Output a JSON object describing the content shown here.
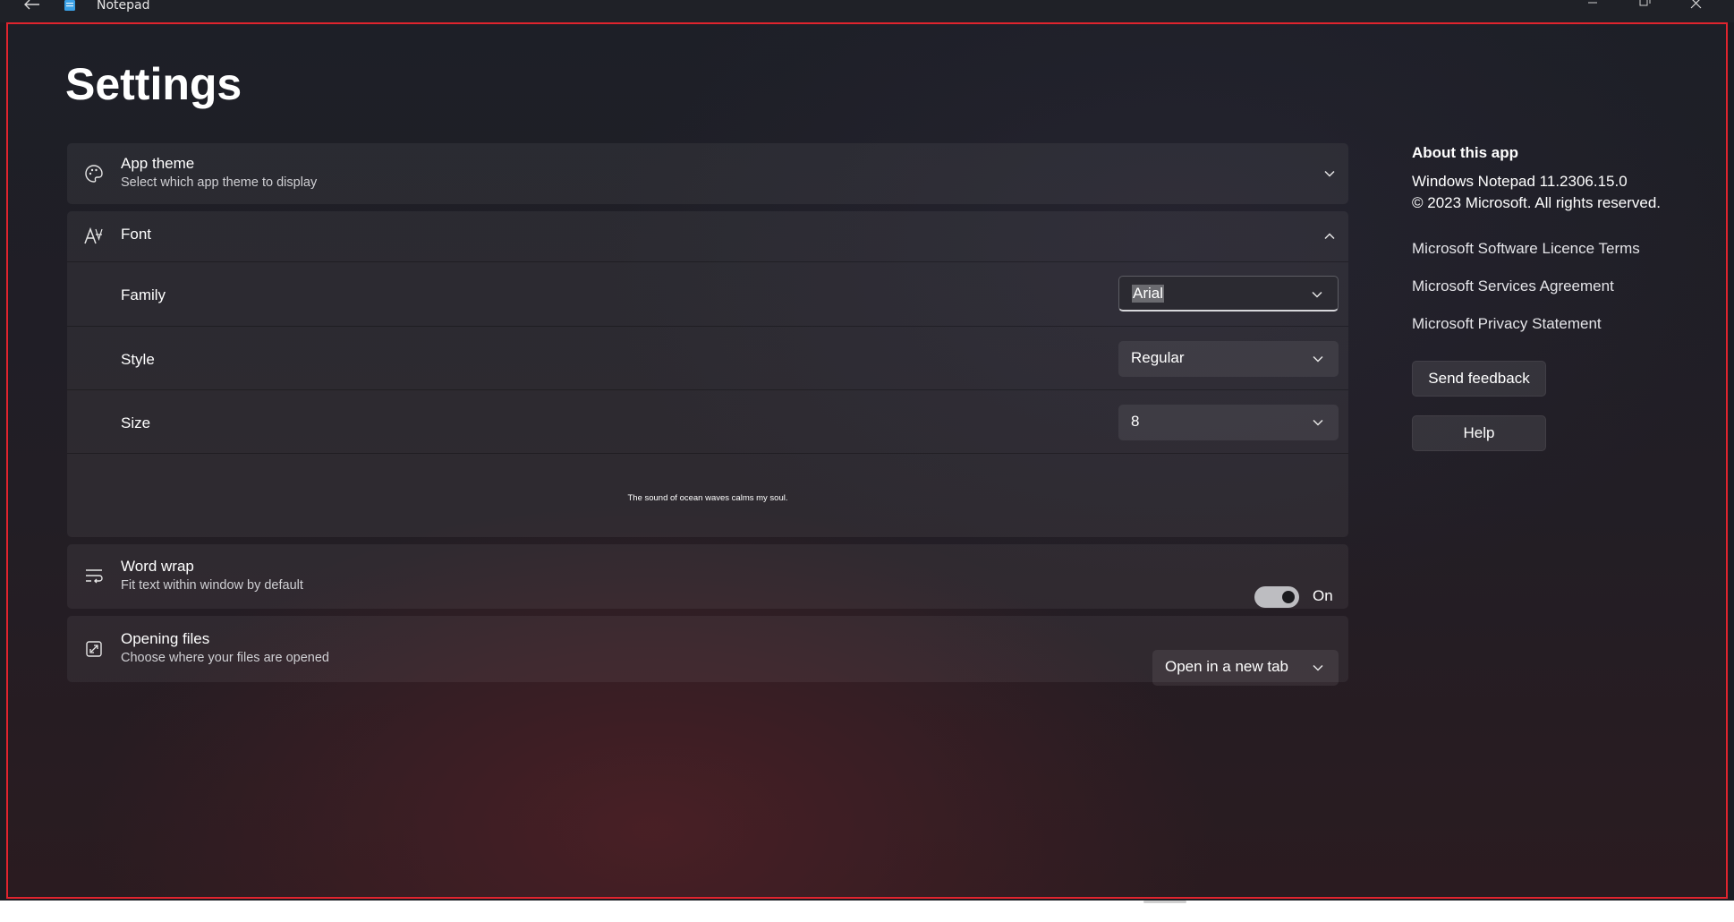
{
  "titlebar": {
    "app_name": "Notepad",
    "icons": {
      "back": "back-arrow-icon",
      "app": "notepad-app-icon",
      "minimize": "minimize-icon",
      "maximize": "restore-icon",
      "close": "close-icon"
    }
  },
  "page": {
    "title": "Settings"
  },
  "app_theme": {
    "title": "App theme",
    "subtitle": "Select which app theme to display",
    "icon": "palette-icon",
    "expanded": false
  },
  "font": {
    "title": "Font",
    "icon": "font-icon",
    "expanded": true,
    "family": {
      "label": "Family",
      "value": "Arial"
    },
    "style": {
      "label": "Style",
      "value": "Regular"
    },
    "size": {
      "label": "Size",
      "value": "8"
    },
    "preview": "The sound of ocean waves calms my soul."
  },
  "word_wrap": {
    "title": "Word wrap",
    "subtitle": "Fit text within window by default",
    "icon": "word-wrap-icon",
    "state_label": "On",
    "enabled": true
  },
  "opening_files": {
    "title": "Opening files",
    "subtitle": "Choose where your files are opened",
    "icon": "open-file-icon",
    "value": "Open in a new tab"
  },
  "about": {
    "heading": "About this app",
    "version": "Windows Notepad 11.2306.15.0",
    "copyright": "© 2023 Microsoft. All rights reserved.",
    "links": [
      "Microsoft Software Licence Terms",
      "Microsoft Services Agreement",
      "Microsoft Privacy Statement"
    ],
    "buttons": {
      "feedback": "Send feedback",
      "help": "Help"
    }
  },
  "colors": {
    "frame_border": "#e0242e",
    "background": "#1b1c22",
    "toggle_on": "#bdbdc1"
  }
}
